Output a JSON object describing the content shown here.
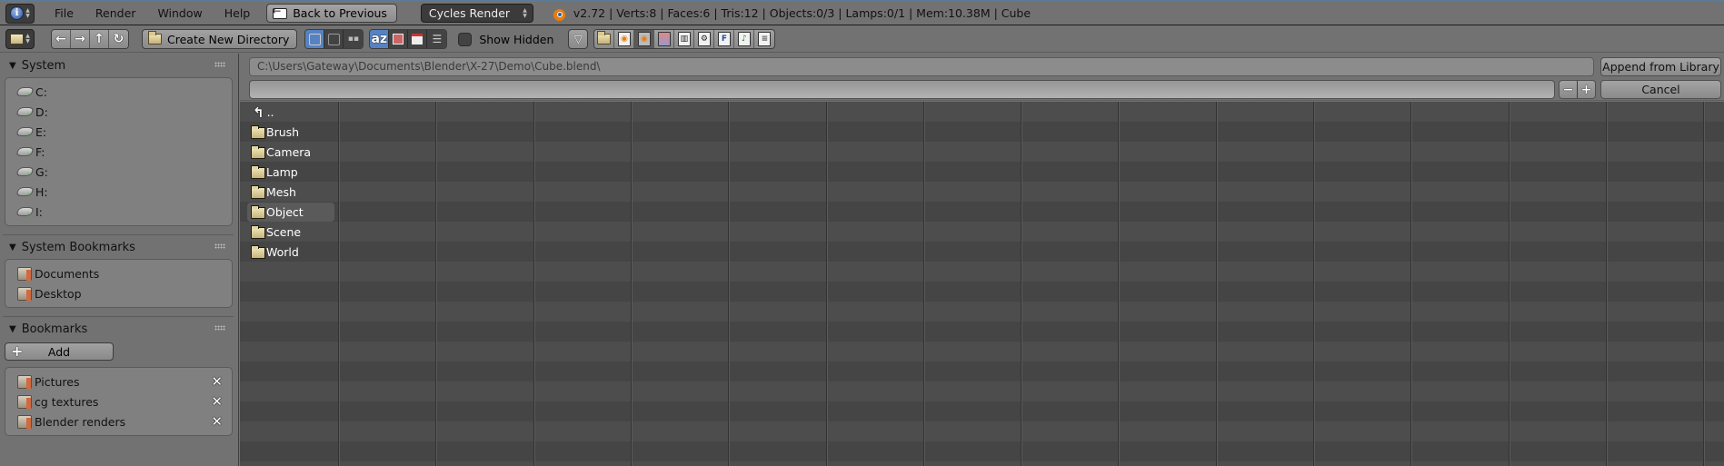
{
  "header": {
    "editor_icon": "info-icon",
    "menu": [
      "File",
      "Render",
      "Window",
      "Help"
    ],
    "back_label": "Back to Previous",
    "render_engine": "Cycles Render",
    "logo_icon": "blender-logo-icon",
    "stats": "v2.72 | Verts:8 | Faces:6 | Tris:12 | Objects:0/3 | Lamps:0/1 | Mem:10.38M | Cube"
  },
  "toolbar": {
    "editor_icon": "file-browser-icon",
    "nav_buttons": [
      {
        "name": "back-arrow",
        "glyph": "←"
      },
      {
        "name": "forward-arrow",
        "glyph": "→"
      },
      {
        "name": "parent-directory",
        "glyph": "↑"
      },
      {
        "name": "refresh",
        "glyph": "↻"
      }
    ],
    "create_dir_label": "Create New Directory",
    "display_modes": [
      {
        "name": "short-list",
        "active": true
      },
      {
        "name": "long-list",
        "active": false
      },
      {
        "name": "thumbnails",
        "active": false
      }
    ],
    "sort_modes": [
      {
        "name": "sort-alpha",
        "glyph": "az",
        "active": true
      },
      {
        "name": "sort-extension",
        "active": false
      },
      {
        "name": "sort-time",
        "active": false
      },
      {
        "name": "sort-size",
        "active": false
      }
    ],
    "show_hidden_label": "Show Hidden",
    "show_hidden_checked": false,
    "filter_icon": "filter-funnel-icon",
    "file_type_filters": [
      "folder",
      "blend",
      "backup-blend",
      "image",
      "movie",
      "script",
      "font",
      "sound",
      "text"
    ]
  },
  "sidebar": {
    "system": {
      "title": "System",
      "drives": [
        "C:",
        "D:",
        "E:",
        "F:",
        "G:",
        "H:",
        "I:"
      ]
    },
    "system_bookmarks": {
      "title": "System Bookmarks",
      "items": [
        "Documents",
        "Desktop"
      ]
    },
    "bookmarks": {
      "title": "Bookmarks",
      "add_label": "Add",
      "items": [
        "Pictures",
        "cg textures",
        "Blender renders"
      ]
    }
  },
  "path": {
    "directory": "C:\\Users\\Gateway\\Documents\\Blender\\X-27\\Demo\\Cube.blend\\",
    "filename": "",
    "append_label": "Append from Library",
    "cancel_label": "Cancel",
    "decrement": "−",
    "increment": "+"
  },
  "files": {
    "parent": "..",
    "folders": [
      "Brush",
      "Camera",
      "Lamp",
      "Mesh",
      "Object",
      "Scene",
      "World"
    ],
    "highlighted": "Object"
  }
}
